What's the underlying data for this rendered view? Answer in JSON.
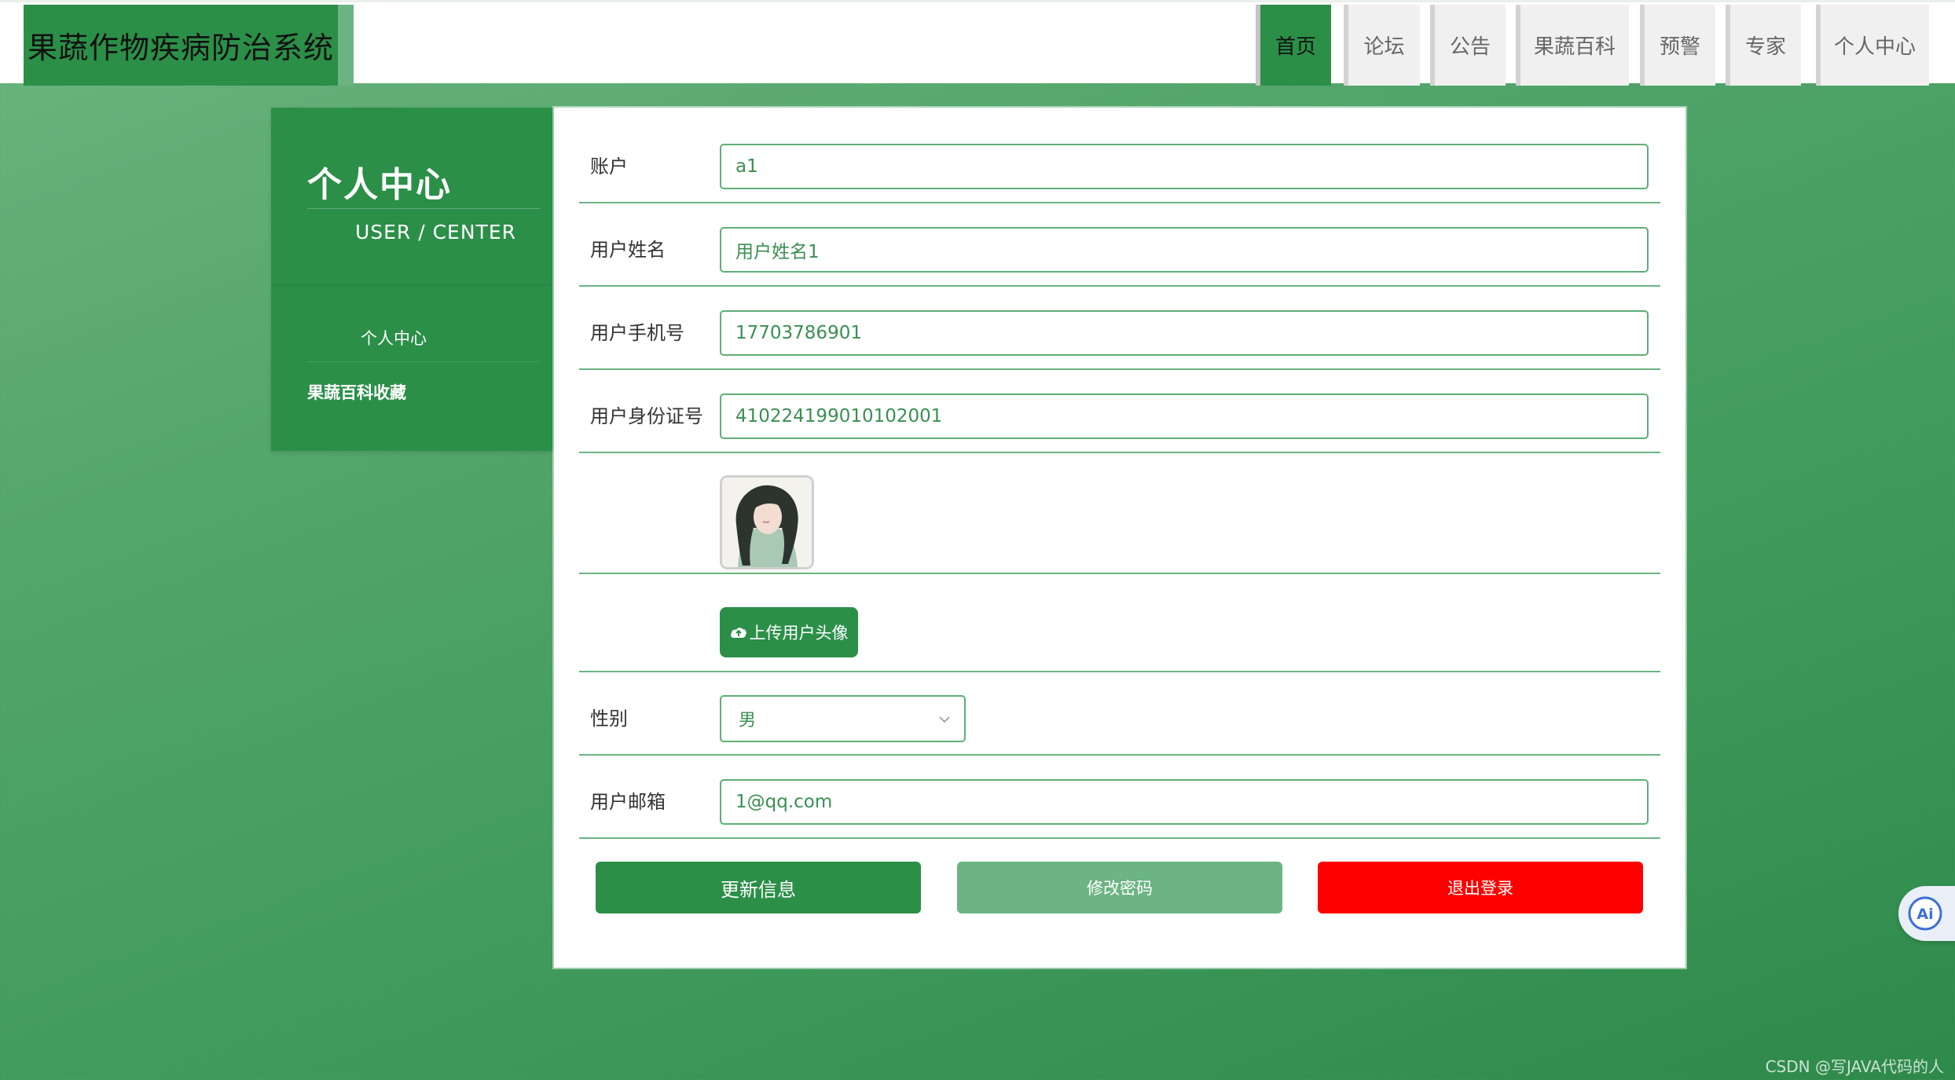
{
  "header": {
    "brand": "果蔬作物疾病防治系统",
    "nav": [
      {
        "label": "首页",
        "active": true
      },
      {
        "label": "论坛",
        "active": false
      },
      {
        "label": "公告",
        "active": false
      },
      {
        "label": "果蔬百科",
        "active": false
      },
      {
        "label": "预警",
        "active": false
      },
      {
        "label": "专家",
        "active": false
      },
      {
        "label": "个人中心",
        "active": false
      }
    ]
  },
  "sidebar": {
    "title": "个人中心",
    "subtitle": "USER / CENTER",
    "items": [
      {
        "label": "个人中心"
      },
      {
        "label": "果蔬百科收藏"
      }
    ]
  },
  "form": {
    "account": {
      "label": "账户",
      "value": "a1"
    },
    "name": {
      "label": "用户姓名",
      "value": "用户姓名1"
    },
    "phone": {
      "label": "用户手机号",
      "value": "17703786901"
    },
    "id_number": {
      "label": "用户身份证号",
      "value": "410224199010102001"
    },
    "upload_label": "上传用户头像",
    "gender": {
      "label": "性别",
      "value": "男"
    },
    "email": {
      "label": "用户邮箱",
      "value": "1@qq.com"
    }
  },
  "actions": {
    "update": "更新信息",
    "change_password": "修改密码",
    "logout": "退出登录"
  },
  "ai_badge": "Ai",
  "watermark": "CSDN @写JAVA代码的人",
  "colors": {
    "primary": "#2b8f48",
    "light": "#6cb483",
    "danger": "#ff0000"
  }
}
